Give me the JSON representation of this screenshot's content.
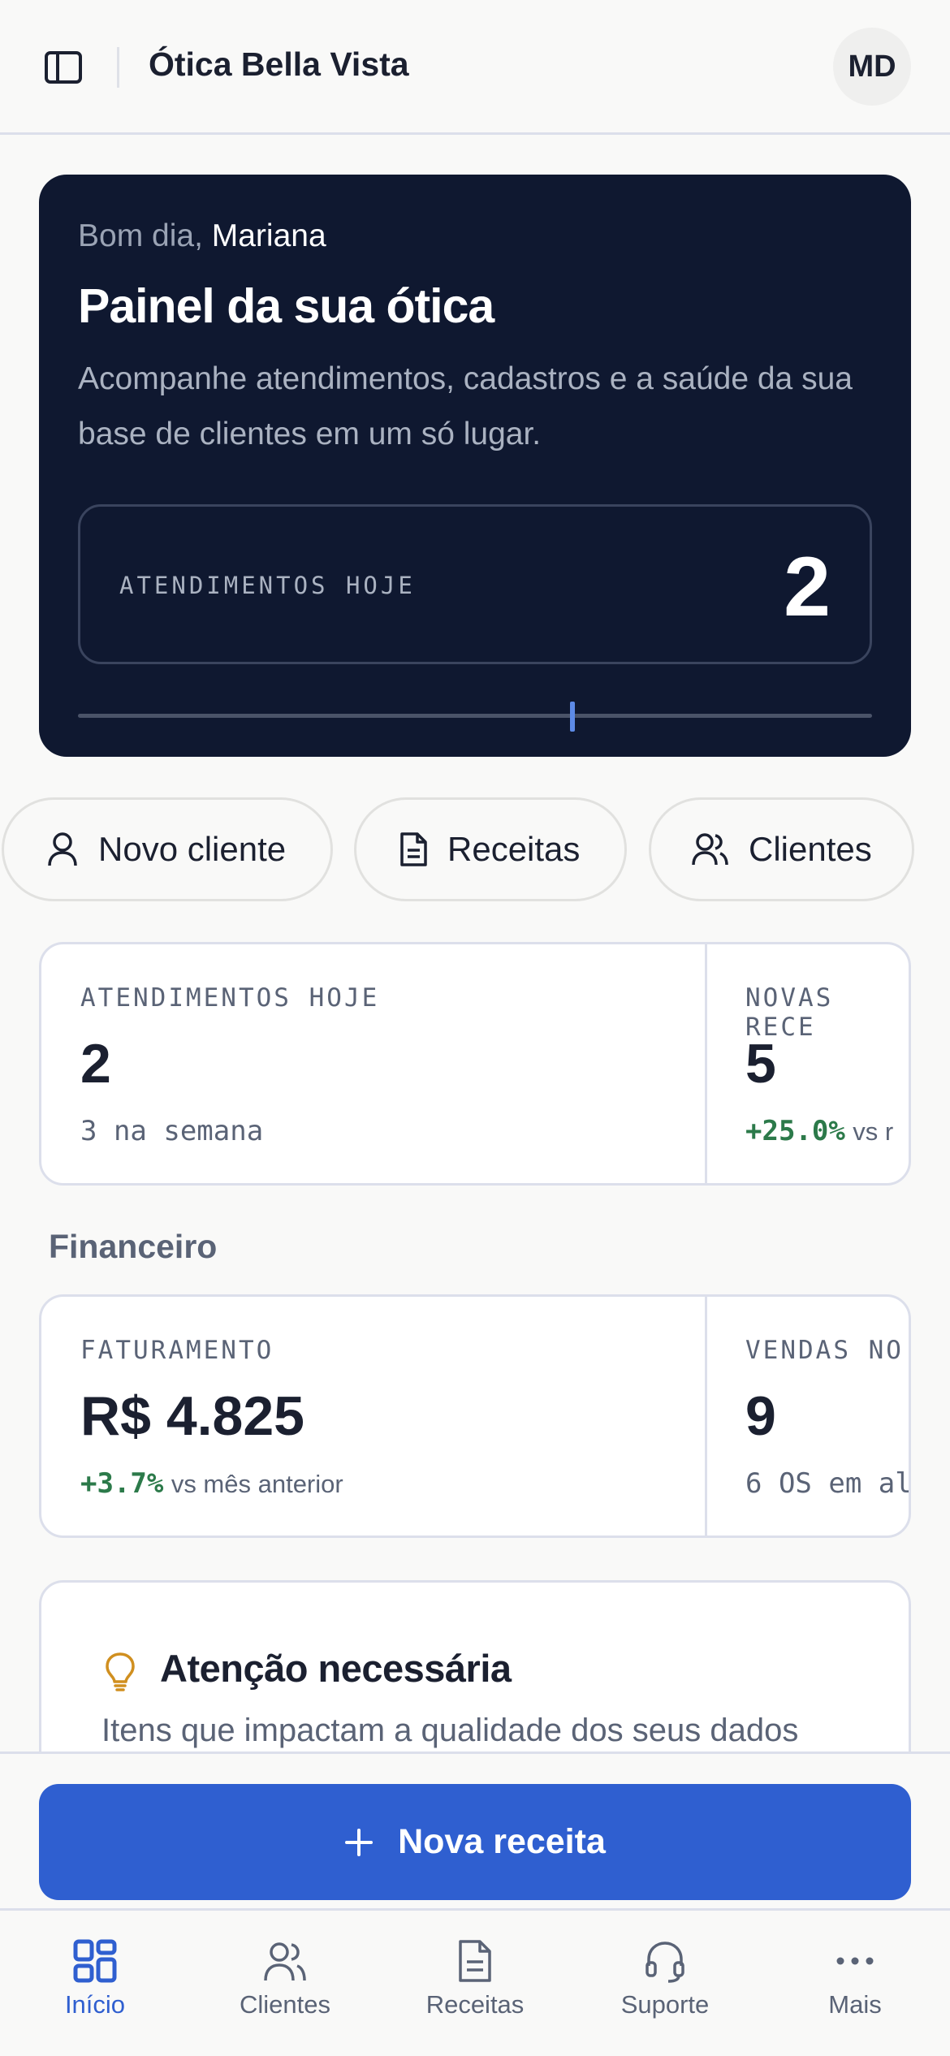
{
  "header": {
    "brand": "Ótica Bella Vista",
    "avatar_initials": "MD"
  },
  "hero": {
    "greeting_prefix": "Bom dia,",
    "user_name": "Mariana",
    "title": "Painel da sua ótica",
    "subtitle": "Acompanhe atendimentos, cadastros e a saúde da sua base de clientes em um só lugar.",
    "stat_label": "ATENDIMENTOS HOJE",
    "stat_value": "2",
    "accent": "#5d8ae6"
  },
  "quick_actions": [
    {
      "label": "Novo cliente",
      "icon": "user-icon"
    },
    {
      "label": "Receitas",
      "icon": "document-icon"
    },
    {
      "label": "Clientes",
      "icon": "users-icon"
    }
  ],
  "metrics": [
    {
      "label": "ATENDIMENTOS HOJE",
      "value": "2",
      "sub": "3 na semana"
    },
    {
      "label": "NOVAS RECE",
      "value": "5",
      "delta": "+25.0%",
      "vs": "vs r"
    }
  ],
  "finance": {
    "section_title": "Financeiro",
    "cards": [
      {
        "label": "FATURAMENTO",
        "value": "R$ 4.825",
        "delta": "+3.7%",
        "vs": "vs mês anterior"
      },
      {
        "label": "VENDAS NO",
        "value": "9",
        "sub": "6 OS em al"
      }
    ]
  },
  "attention": {
    "title": "Atenção necessária",
    "subtitle": "Itens que impactam a qualidade dos seus dados",
    "icon": "lightbulb-icon"
  },
  "cta": {
    "label": "Nova receita",
    "color": "#2f5fd0"
  },
  "tabs": [
    {
      "label": "Início",
      "icon": "dashboard-icon",
      "active": true
    },
    {
      "label": "Clientes",
      "icon": "users-icon"
    },
    {
      "label": "Receitas",
      "icon": "document-icon"
    },
    {
      "label": "Suporte",
      "icon": "headset-icon"
    },
    {
      "label": "Mais",
      "icon": "more-icon"
    }
  ]
}
